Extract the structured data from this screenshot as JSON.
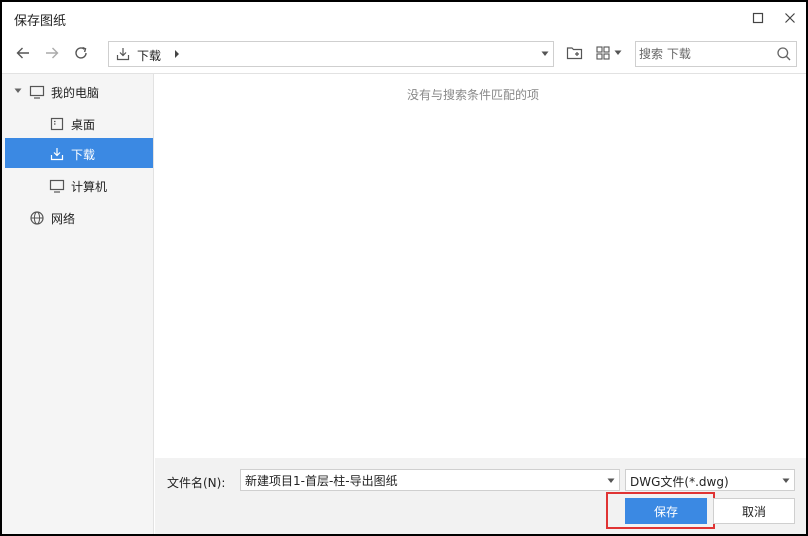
{
  "window": {
    "title": "保存图纸"
  },
  "toolbar": {
    "address": {
      "icon": "download-icon",
      "path": "下载"
    },
    "search": {
      "placeholder": "搜索 下载"
    }
  },
  "sidebar": {
    "items": [
      {
        "label": "我的电脑",
        "icon": "monitor-icon",
        "expanded": true,
        "selected": false
      },
      {
        "label": "桌面",
        "icon": "desktop-icon",
        "selected": false
      },
      {
        "label": "下载",
        "icon": "download-icon",
        "selected": true
      },
      {
        "label": "计算机",
        "icon": "computer-icon",
        "selected": false
      },
      {
        "label": "网络",
        "icon": "globe-icon",
        "selected": false
      }
    ]
  },
  "main": {
    "empty_message": "没有与搜索条件匹配的项"
  },
  "footer": {
    "filename_label": "文件名(N):",
    "filename_value": "新建项目1-首层-柱-导出图纸",
    "filetype_value": "DWG文件(*.dwg)",
    "save_label": "保存",
    "cancel_label": "取消"
  },
  "colors": {
    "accent": "#3b89e3",
    "highlight": "#e03434",
    "sidebar_bg": "#f5f5f5"
  }
}
